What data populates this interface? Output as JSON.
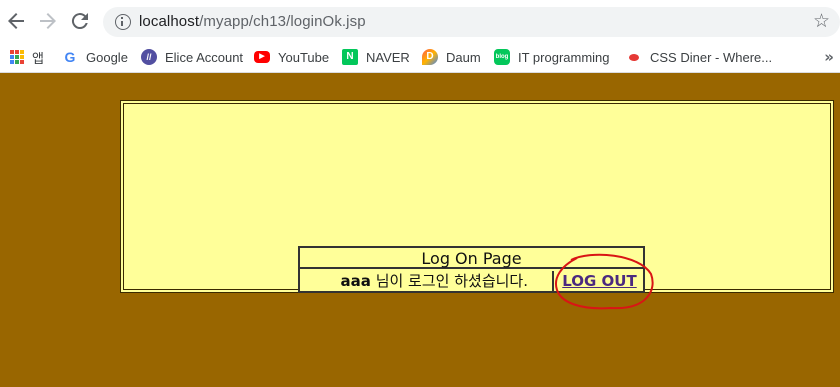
{
  "browser": {
    "url_host": "localhost",
    "url_path": "/myapp/ch13/loginOk.jsp",
    "bookmarks": [
      {
        "label": "앱",
        "icon": "apps-grid-icon"
      },
      {
        "label": "Google",
        "icon": "google-icon",
        "color": "#4285f4"
      },
      {
        "label": "Elice Account",
        "icon": "elice-icon",
        "color": "#524fa1"
      },
      {
        "label": "YouTube",
        "icon": "youtube-icon",
        "color": "#ff0000"
      },
      {
        "label": "NAVER",
        "icon": "naver-icon",
        "color": "#03c75a"
      },
      {
        "label": "Daum",
        "icon": "daum-icon",
        "color": "#ff5a4a"
      },
      {
        "label": "IT programming",
        "icon": "blog-icon",
        "color": "#03c75a"
      },
      {
        "label": "CSS Diner - Where...",
        "icon": "css-diner-icon",
        "color": "#e53935"
      }
    ]
  },
  "page": {
    "background": "#996600",
    "box_background": "#ffff99",
    "title": "Log On Page",
    "user": "aaa",
    "message": " 님이 로그인 하셨습니다.",
    "logout_label": "LOG OUT"
  }
}
